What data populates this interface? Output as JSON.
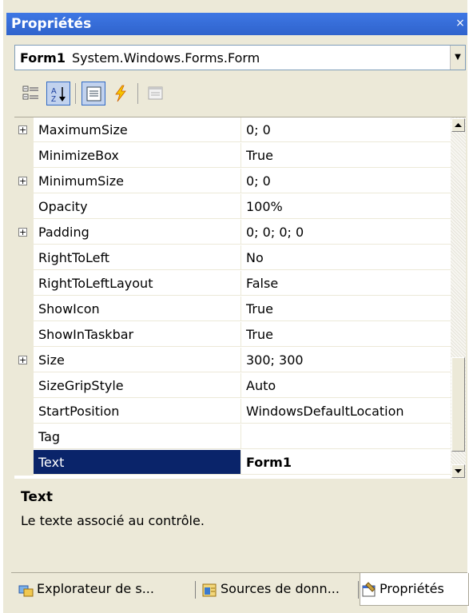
{
  "window": {
    "title": "Propriétés",
    "close_glyph": "×"
  },
  "object_selector": {
    "name": "Form1",
    "type": "System.Windows.Forms.Form"
  },
  "toolbar": {
    "buttons": [
      {
        "name": "categorized-icon",
        "active": false
      },
      {
        "name": "alphabetical-icon",
        "active": true
      },
      {
        "name": "properties-icon",
        "active": true
      },
      {
        "name": "events-lightning-icon",
        "active": false
      },
      {
        "name": "property-pages-icon",
        "active": false
      }
    ]
  },
  "properties": [
    {
      "name": "MaximumSize",
      "value": "0; 0",
      "expandable": true
    },
    {
      "name": "MinimizeBox",
      "value": "True",
      "expandable": false
    },
    {
      "name": "MinimumSize",
      "value": "0; 0",
      "expandable": true
    },
    {
      "name": "Opacity",
      "value": "100%",
      "expandable": false
    },
    {
      "name": "Padding",
      "value": "0; 0; 0; 0",
      "expandable": true
    },
    {
      "name": "RightToLeft",
      "value": "No",
      "expandable": false
    },
    {
      "name": "RightToLeftLayout",
      "value": "False",
      "expandable": false
    },
    {
      "name": "ShowIcon",
      "value": "True",
      "expandable": false
    },
    {
      "name": "ShowInTaskbar",
      "value": "True",
      "expandable": false
    },
    {
      "name": "Size",
      "value": "300; 300",
      "expandable": true
    },
    {
      "name": "SizeGripStyle",
      "value": "Auto",
      "expandable": false
    },
    {
      "name": "StartPosition",
      "value": "WindowsDefaultLocation",
      "expandable": false
    },
    {
      "name": "Tag",
      "value": "",
      "expandable": false
    },
    {
      "name": "Text",
      "value": "Form1",
      "expandable": false,
      "selected": true
    }
  ],
  "description": {
    "title": "Text",
    "text": "Le texte associé au contrôle."
  },
  "tabs": [
    {
      "label": "Explorateur de s...",
      "icon": "solution-explorer-icon",
      "active": false
    },
    {
      "label": "Sources de donn...",
      "icon": "data-sources-icon",
      "active": false
    },
    {
      "label": "Propriétés",
      "icon": "properties-window-icon",
      "active": true
    }
  ],
  "colors": {
    "title_bar": "#3e77e4",
    "selection": "#0a246a",
    "panel": "#ece9d8"
  }
}
